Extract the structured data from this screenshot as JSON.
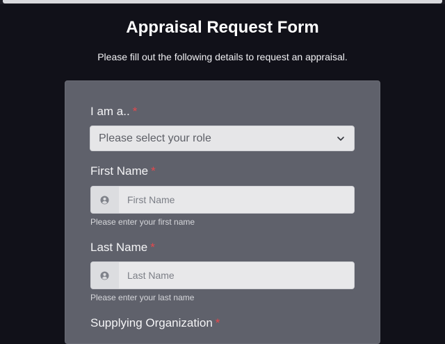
{
  "header": {
    "title": "Appraisal Request Form",
    "subtitle": "Please fill out the following details to request an appraisal."
  },
  "form": {
    "required_mark": "*",
    "role": {
      "label": "I am a..",
      "selected": "Please select your role"
    },
    "first_name": {
      "label": "First Name",
      "placeholder": "First Name",
      "help": "Please enter your first name"
    },
    "last_name": {
      "label": "Last Name",
      "placeholder": "Last Name",
      "help": "Please enter your last name"
    },
    "organization": {
      "label": "Supplying Organization"
    }
  },
  "icons": {
    "user": "user-circle-icon",
    "chevron": "chevron-down-icon"
  },
  "colors": {
    "background": "#111119",
    "card": "#5f616b",
    "required": "#e5484d"
  }
}
